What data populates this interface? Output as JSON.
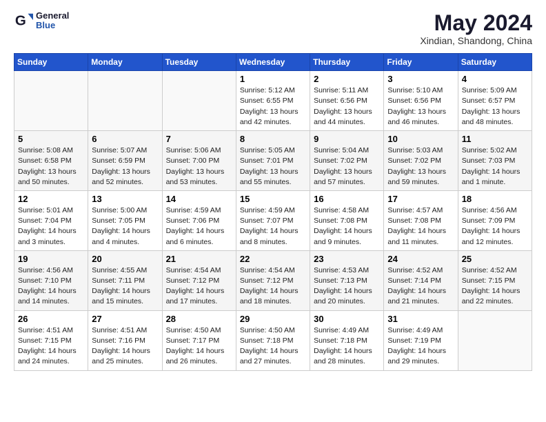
{
  "header": {
    "logo_line1": "General",
    "logo_line2": "Blue",
    "month_year": "May 2024",
    "location": "Xindian, Shandong, China"
  },
  "weekdays": [
    "Sunday",
    "Monday",
    "Tuesday",
    "Wednesday",
    "Thursday",
    "Friday",
    "Saturday"
  ],
  "weeks": [
    [
      {
        "day": "",
        "info": ""
      },
      {
        "day": "",
        "info": ""
      },
      {
        "day": "",
        "info": ""
      },
      {
        "day": "1",
        "info": "Sunrise: 5:12 AM\nSunset: 6:55 PM\nDaylight: 13 hours\nand 42 minutes."
      },
      {
        "day": "2",
        "info": "Sunrise: 5:11 AM\nSunset: 6:56 PM\nDaylight: 13 hours\nand 44 minutes."
      },
      {
        "day": "3",
        "info": "Sunrise: 5:10 AM\nSunset: 6:56 PM\nDaylight: 13 hours\nand 46 minutes."
      },
      {
        "day": "4",
        "info": "Sunrise: 5:09 AM\nSunset: 6:57 PM\nDaylight: 13 hours\nand 48 minutes."
      }
    ],
    [
      {
        "day": "5",
        "info": "Sunrise: 5:08 AM\nSunset: 6:58 PM\nDaylight: 13 hours\nand 50 minutes."
      },
      {
        "day": "6",
        "info": "Sunrise: 5:07 AM\nSunset: 6:59 PM\nDaylight: 13 hours\nand 52 minutes."
      },
      {
        "day": "7",
        "info": "Sunrise: 5:06 AM\nSunset: 7:00 PM\nDaylight: 13 hours\nand 53 minutes."
      },
      {
        "day": "8",
        "info": "Sunrise: 5:05 AM\nSunset: 7:01 PM\nDaylight: 13 hours\nand 55 minutes."
      },
      {
        "day": "9",
        "info": "Sunrise: 5:04 AM\nSunset: 7:02 PM\nDaylight: 13 hours\nand 57 minutes."
      },
      {
        "day": "10",
        "info": "Sunrise: 5:03 AM\nSunset: 7:02 PM\nDaylight: 13 hours\nand 59 minutes."
      },
      {
        "day": "11",
        "info": "Sunrise: 5:02 AM\nSunset: 7:03 PM\nDaylight: 14 hours\nand 1 minute."
      }
    ],
    [
      {
        "day": "12",
        "info": "Sunrise: 5:01 AM\nSunset: 7:04 PM\nDaylight: 14 hours\nand 3 minutes."
      },
      {
        "day": "13",
        "info": "Sunrise: 5:00 AM\nSunset: 7:05 PM\nDaylight: 14 hours\nand 4 minutes."
      },
      {
        "day": "14",
        "info": "Sunrise: 4:59 AM\nSunset: 7:06 PM\nDaylight: 14 hours\nand 6 minutes."
      },
      {
        "day": "15",
        "info": "Sunrise: 4:59 AM\nSunset: 7:07 PM\nDaylight: 14 hours\nand 8 minutes."
      },
      {
        "day": "16",
        "info": "Sunrise: 4:58 AM\nSunset: 7:08 PM\nDaylight: 14 hours\nand 9 minutes."
      },
      {
        "day": "17",
        "info": "Sunrise: 4:57 AM\nSunset: 7:08 PM\nDaylight: 14 hours\nand 11 minutes."
      },
      {
        "day": "18",
        "info": "Sunrise: 4:56 AM\nSunset: 7:09 PM\nDaylight: 14 hours\nand 12 minutes."
      }
    ],
    [
      {
        "day": "19",
        "info": "Sunrise: 4:56 AM\nSunset: 7:10 PM\nDaylight: 14 hours\nand 14 minutes."
      },
      {
        "day": "20",
        "info": "Sunrise: 4:55 AM\nSunset: 7:11 PM\nDaylight: 14 hours\nand 15 minutes."
      },
      {
        "day": "21",
        "info": "Sunrise: 4:54 AM\nSunset: 7:12 PM\nDaylight: 14 hours\nand 17 minutes."
      },
      {
        "day": "22",
        "info": "Sunrise: 4:54 AM\nSunset: 7:12 PM\nDaylight: 14 hours\nand 18 minutes."
      },
      {
        "day": "23",
        "info": "Sunrise: 4:53 AM\nSunset: 7:13 PM\nDaylight: 14 hours\nand 20 minutes."
      },
      {
        "day": "24",
        "info": "Sunrise: 4:52 AM\nSunset: 7:14 PM\nDaylight: 14 hours\nand 21 minutes."
      },
      {
        "day": "25",
        "info": "Sunrise: 4:52 AM\nSunset: 7:15 PM\nDaylight: 14 hours\nand 22 minutes."
      }
    ],
    [
      {
        "day": "26",
        "info": "Sunrise: 4:51 AM\nSunset: 7:15 PM\nDaylight: 14 hours\nand 24 minutes."
      },
      {
        "day": "27",
        "info": "Sunrise: 4:51 AM\nSunset: 7:16 PM\nDaylight: 14 hours\nand 25 minutes."
      },
      {
        "day": "28",
        "info": "Sunrise: 4:50 AM\nSunset: 7:17 PM\nDaylight: 14 hours\nand 26 minutes."
      },
      {
        "day": "29",
        "info": "Sunrise: 4:50 AM\nSunset: 7:18 PM\nDaylight: 14 hours\nand 27 minutes."
      },
      {
        "day": "30",
        "info": "Sunrise: 4:49 AM\nSunset: 7:18 PM\nDaylight: 14 hours\nand 28 minutes."
      },
      {
        "day": "31",
        "info": "Sunrise: 4:49 AM\nSunset: 7:19 PM\nDaylight: 14 hours\nand 29 minutes."
      },
      {
        "day": "",
        "info": ""
      }
    ]
  ]
}
